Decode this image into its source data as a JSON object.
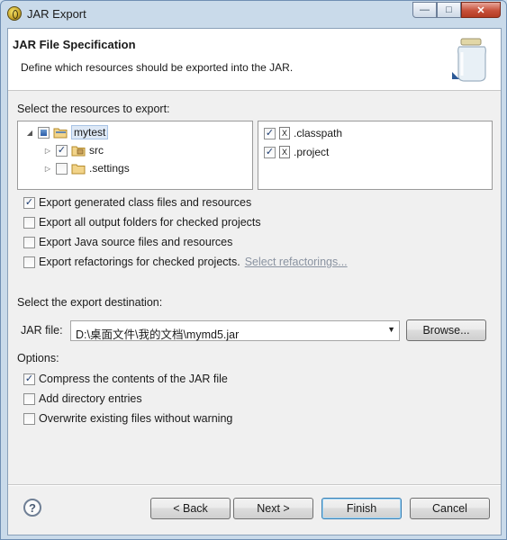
{
  "window": {
    "title": "JAR Export",
    "minimize_glyph": "—",
    "maximize_glyph": "□",
    "close_glyph": "✕"
  },
  "header": {
    "title": "JAR File Specification",
    "description": "Define which resources should be exported into the JAR."
  },
  "resources": {
    "label": "Select the resources to export:",
    "tree": [
      {
        "label": "mytest",
        "expander": "◢",
        "check": "partial",
        "selected": true,
        "icon": "project-folder-icon"
      },
      {
        "label": "src",
        "expander": "▷",
        "check": "checked",
        "icon": "package-folder-icon"
      },
      {
        "label": ".settings",
        "expander": "▷",
        "check": "unchecked",
        "icon": "folder-icon"
      }
    ],
    "files": [
      {
        "label": ".classpath",
        "check": "checked",
        "icon_glyph": "X"
      },
      {
        "label": ".project",
        "check": "checked",
        "icon_glyph": "X"
      }
    ]
  },
  "export_options": [
    {
      "label": "Export generated class files and resources",
      "checked": true
    },
    {
      "label": "Export all output folders for checked projects",
      "checked": false
    },
    {
      "label": "Export Java source files and resources",
      "checked": false
    },
    {
      "label": "Export refactorings for checked projects.",
      "checked": false,
      "link": "Select refactorings..."
    }
  ],
  "destination": {
    "label": "Select the export destination:",
    "jar_file_label": "JAR file:",
    "jar_file_value": "D:\\桌面文件\\我的文档\\mymd5.jar",
    "browse_label": "Browse..."
  },
  "options": {
    "label": "Options:",
    "items": [
      {
        "label": "Compress the contents of the JAR file",
        "checked": true
      },
      {
        "label": "Add directory entries",
        "checked": false
      },
      {
        "label": "Overwrite existing files without warning",
        "checked": false
      }
    ]
  },
  "footer": {
    "help_glyph": "?",
    "back_label": "< Back",
    "next_label": "Next >",
    "finish_label": "Finish",
    "cancel_label": "Cancel"
  },
  "colors": {
    "accent": "#3c7fb1",
    "checkmark": "#1d3c72",
    "close_button": "#c7503a"
  }
}
